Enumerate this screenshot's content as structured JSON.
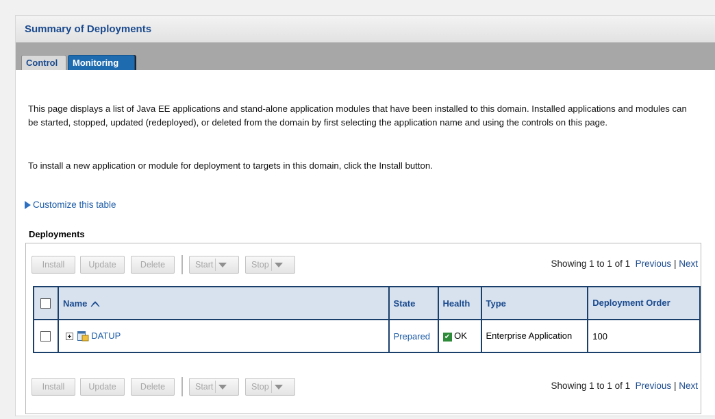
{
  "page": {
    "title": "Summary of Deployments"
  },
  "tabs": [
    {
      "label": "Control"
    },
    {
      "label": "Monitoring"
    }
  ],
  "description": {
    "p1": "This page displays a list of Java EE applications and stand-alone application modules that have been installed to this domain. Installed applications and modules can be started, stopped, updated (redeployed), or deleted from the domain by first selecting the application name and using the controls on this page.",
    "p2": "To install a new application or module for deployment to targets in this domain, click the Install button."
  },
  "customize_link": "Customize this table",
  "deployments": {
    "heading": "Deployments",
    "buttons": {
      "install": "Install",
      "update": "Update",
      "delete": "Delete",
      "start": "Start",
      "stop": "Stop"
    },
    "paging": {
      "showing": "Showing 1 to 1 of 1",
      "previous": "Previous",
      "separator": "|",
      "next": "Next"
    },
    "columns": {
      "name": "Name",
      "state": "State",
      "health": "Health",
      "type": "Type",
      "order": "Deployment Order"
    },
    "rows": [
      {
        "name": "DATUP",
        "state": "Prepared",
        "health": "OK",
        "type": "Enterprise Application",
        "order": "100"
      }
    ]
  },
  "icons": {
    "expand": "plus-box-icon",
    "app": "enterprise-app-icon",
    "sort": "sort-ascending-icon",
    "health": "ok-check-icon",
    "customize": "triangle-right-icon"
  }
}
